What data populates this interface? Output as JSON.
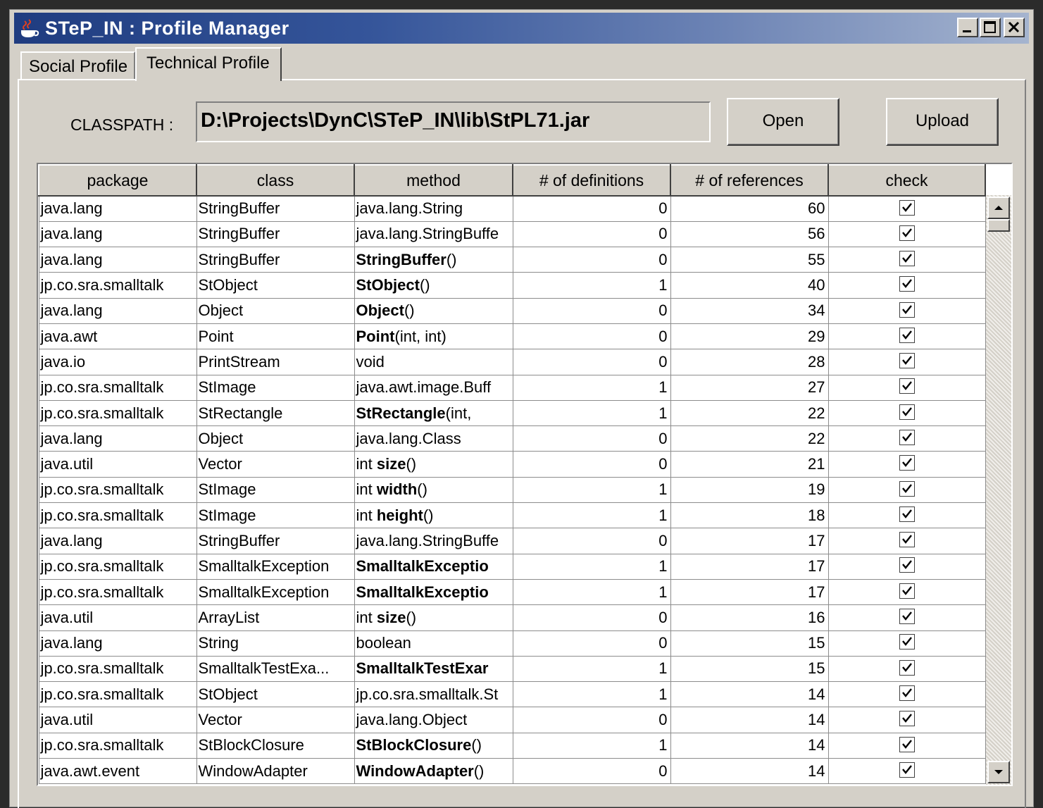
{
  "window": {
    "title": "STeP_IN : Profile Manager",
    "minimize_icon": "minimize-icon",
    "maximize_icon": "maximize-icon",
    "close_icon": "close-icon"
  },
  "tabs": [
    {
      "label": "Social Profile",
      "selected": false
    },
    {
      "label": "Technical Profile",
      "selected": true
    }
  ],
  "classpath": {
    "label": "CLASSPATH :",
    "value": "D:\\Projects\\DynC\\STeP_IN\\lib\\StPL71.jar"
  },
  "buttons": {
    "open": "Open",
    "upload": "Upload"
  },
  "table": {
    "columns": [
      "package",
      "class",
      "method",
      "# of definitions",
      "# of references",
      "check"
    ],
    "rows": [
      {
        "package": "java.lang",
        "class": "StringBuffer",
        "method_pre": "java.lang.String",
        "method_bold": "",
        "method_post": "",
        "defs": "0",
        "refs": "60",
        "checked": true
      },
      {
        "package": "java.lang",
        "class": "StringBuffer",
        "method_pre": "java.lang.StringBuffe",
        "method_bold": "",
        "method_post": "",
        "defs": "0",
        "refs": "56",
        "checked": true
      },
      {
        "package": "java.lang",
        "class": "StringBuffer",
        "method_pre": "",
        "method_bold": "StringBuffer",
        "method_post": "()",
        "defs": "0",
        "refs": "55",
        "checked": true
      },
      {
        "package": "jp.co.sra.smalltalk",
        "class": "StObject",
        "method_pre": "",
        "method_bold": "StObject",
        "method_post": "()",
        "defs": "1",
        "refs": "40",
        "checked": true
      },
      {
        "package": "java.lang",
        "class": "Object",
        "method_pre": "",
        "method_bold": "Object",
        "method_post": "()",
        "defs": "0",
        "refs": "34",
        "checked": true
      },
      {
        "package": "java.awt",
        "class": "Point",
        "method_pre": "",
        "method_bold": "Point",
        "method_post": "(int, int)",
        "defs": "0",
        "refs": "29",
        "checked": true
      },
      {
        "package": "java.io",
        "class": "PrintStream",
        "method_pre": "void",
        "method_bold": "",
        "method_post": "",
        "defs": "0",
        "refs": "28",
        "checked": true
      },
      {
        "package": "jp.co.sra.smalltalk",
        "class": "StImage",
        "method_pre": "java.awt.image.Buff",
        "method_bold": "",
        "method_post": "",
        "defs": "1",
        "refs": "27",
        "checked": true
      },
      {
        "package": "jp.co.sra.smalltalk",
        "class": "StRectangle",
        "method_pre": "",
        "method_bold": "StRectangle",
        "method_post": "(int,",
        "defs": "1",
        "refs": "22",
        "checked": true
      },
      {
        "package": "java.lang",
        "class": "Object",
        "method_pre": "java.lang.Class",
        "method_bold": "",
        "method_post": "",
        "defs": "0",
        "refs": "22",
        "checked": true
      },
      {
        "package": "java.util",
        "class": "Vector",
        "method_pre": "int ",
        "method_bold": "size",
        "method_post": "()",
        "defs": "0",
        "refs": "21",
        "checked": true
      },
      {
        "package": "jp.co.sra.smalltalk",
        "class": "StImage",
        "method_pre": "int ",
        "method_bold": "width",
        "method_post": "()",
        "defs": "1",
        "refs": "19",
        "checked": true
      },
      {
        "package": "jp.co.sra.smalltalk",
        "class": "StImage",
        "method_pre": "int ",
        "method_bold": "height",
        "method_post": "()",
        "defs": "1",
        "refs": "18",
        "checked": true
      },
      {
        "package": "java.lang",
        "class": "StringBuffer",
        "method_pre": "java.lang.StringBuffe",
        "method_bold": "",
        "method_post": "",
        "defs": "0",
        "refs": "17",
        "checked": true
      },
      {
        "package": "jp.co.sra.smalltalk",
        "class": "SmalltalkException",
        "method_pre": "",
        "method_bold": "SmalltalkExceptio",
        "method_post": "",
        "defs": "1",
        "refs": "17",
        "checked": true
      },
      {
        "package": "jp.co.sra.smalltalk",
        "class": "SmalltalkException",
        "method_pre": "",
        "method_bold": "SmalltalkExceptio",
        "method_post": "",
        "defs": "1",
        "refs": "17",
        "checked": true
      },
      {
        "package": "java.util",
        "class": "ArrayList",
        "method_pre": "int ",
        "method_bold": "size",
        "method_post": "()",
        "defs": "0",
        "refs": "16",
        "checked": true
      },
      {
        "package": "java.lang",
        "class": "String",
        "method_pre": "boolean",
        "method_bold": "",
        "method_post": "",
        "defs": "0",
        "refs": "15",
        "checked": true
      },
      {
        "package": "jp.co.sra.smalltalk",
        "class": "SmalltalkTestExa...",
        "method_pre": "",
        "method_bold": "SmalltalkTestExar",
        "method_post": "",
        "defs": "1",
        "refs": "15",
        "checked": true
      },
      {
        "package": "jp.co.sra.smalltalk",
        "class": "StObject",
        "method_pre": "jp.co.sra.smalltalk.St",
        "method_bold": "",
        "method_post": "",
        "defs": "1",
        "refs": "14",
        "checked": true
      },
      {
        "package": "java.util",
        "class": "Vector",
        "method_pre": "java.lang.Object",
        "method_bold": "",
        "method_post": "",
        "defs": "0",
        "refs": "14",
        "checked": true
      },
      {
        "package": "jp.co.sra.smalltalk",
        "class": "StBlockClosure",
        "method_pre": "",
        "method_bold": "StBlockClosure",
        "method_post": "()",
        "defs": "1",
        "refs": "14",
        "checked": true
      },
      {
        "package": "java.awt.event",
        "class": "WindowAdapter",
        "method_pre": "",
        "method_bold": "WindowAdapter",
        "method_post": "()",
        "defs": "0",
        "refs": "14",
        "checked": true
      }
    ]
  },
  "scrollbar": {
    "up_icon": "scroll-up-arrow-icon",
    "down_icon": "scroll-down-arrow-icon"
  }
}
